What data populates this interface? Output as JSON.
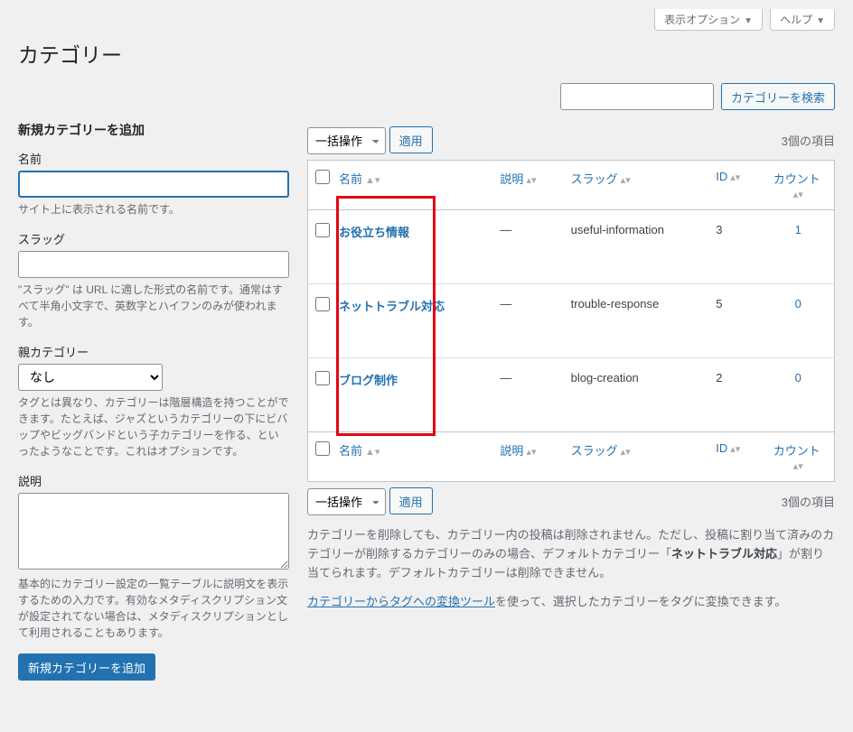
{
  "top": {
    "screen_options": "表示オプション",
    "help": "ヘルプ"
  },
  "page_title": "カテゴリー",
  "search_button": "カテゴリーを検索",
  "form": {
    "heading": "新規カテゴリーを追加",
    "name_label": "名前",
    "name_desc": "サイト上に表示される名前です。",
    "slug_label": "スラッグ",
    "slug_desc": "\"スラッグ\" は URL に適した形式の名前です。通常はすべて半角小文字で、英数字とハイフンのみが使われます。",
    "parent_label": "親カテゴリー",
    "parent_option": "なし",
    "parent_desc": "タグとは異なり、カテゴリーは階層構造を持つことができます。たとえば、ジャズというカテゴリーの下にビバップやビッグバンドという子カテゴリーを作る、といったようなことです。これはオプションです。",
    "desc_label": "説明",
    "desc_desc": "基本的にカテゴリー設定の一覧テーブルに説明文を表示するための入力です。有効なメタディスクリプション文が設定されてない場合は、メタディスクリプションとして利用されることもあります。",
    "submit": "新規カテゴリーを追加"
  },
  "bulk": {
    "label": "一括操作",
    "apply": "適用"
  },
  "items_count": "3個の項目",
  "columns": {
    "name": "名前",
    "description": "説明",
    "slug": "スラッグ",
    "id": "ID",
    "count": "カウント"
  },
  "rows": [
    {
      "name": "お役立ち情報",
      "desc": "—",
      "slug": "useful-information",
      "id": "3",
      "count": "1"
    },
    {
      "name": "ネットトラブル対応",
      "desc": "—",
      "slug": "trouble-response",
      "id": "5",
      "count": "0"
    },
    {
      "name": "ブログ制作",
      "desc": "—",
      "slug": "blog-creation",
      "id": "2",
      "count": "0"
    }
  ],
  "notice": {
    "line1a": "カテゴリーを削除しても、カテゴリー内の投稿は削除されません。ただし、投稿に割り当て済みのカテゴリーが削除するカテゴリーのみの場合、デフォルトカテゴリー「",
    "line1b": "ネットトラブル対応",
    "line1c": "」が割り当てられます。デフォルトカテゴリーは削除できません。",
    "link": "カテゴリーからタグへの変換ツール",
    "line2": "を使って、選択したカテゴリーをタグに変換できます。"
  }
}
